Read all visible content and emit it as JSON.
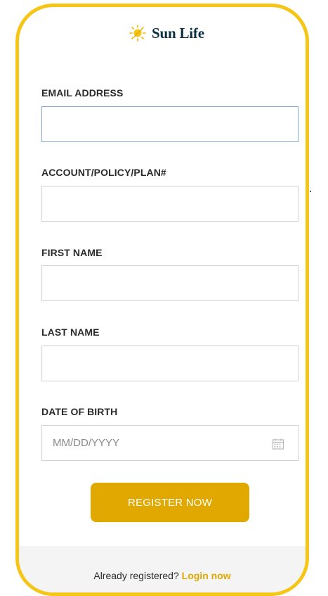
{
  "brand": {
    "name": "Sun Life",
    "accent": "#f5c518",
    "button_color": "#e0a800",
    "logo_icon": "sun-icon"
  },
  "form": {
    "email_label": "EMAIL ADDRESS",
    "email_value": "",
    "account_label": "ACCOUNT/POLICY/PLAN#",
    "account_value": "",
    "first_name_label": "FIRST NAME",
    "first_name_value": "",
    "last_name_label": "LAST NAME",
    "last_name_value": "",
    "dob_label": "DATE OF BIRTH",
    "dob_placeholder": "MM/DD/YYYY",
    "dob_icon": "calendar-icon",
    "submit_label": "REGISTER NOW"
  },
  "footer": {
    "prompt": "Already registered?",
    "link": "Login now"
  }
}
